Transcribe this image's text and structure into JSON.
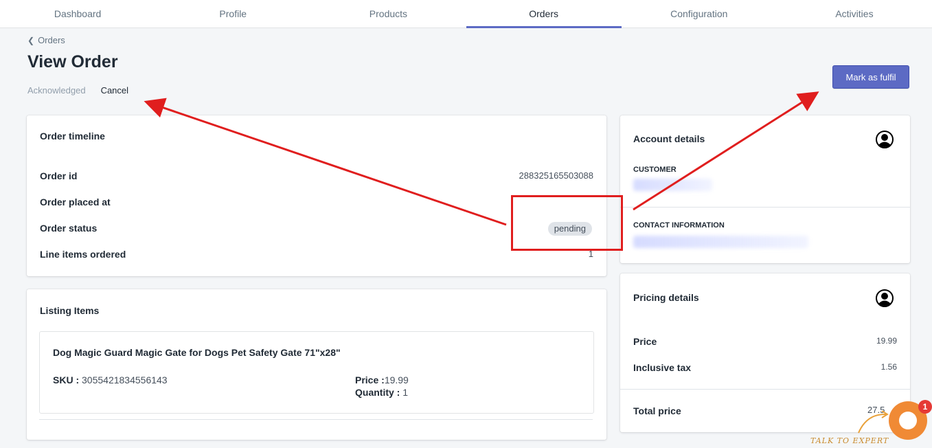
{
  "nav": {
    "tabs": [
      {
        "label": "Dashboard"
      },
      {
        "label": "Profile"
      },
      {
        "label": "Products"
      },
      {
        "label": "Orders"
      },
      {
        "label": "Configuration"
      },
      {
        "label": "Activities"
      }
    ],
    "active": "Orders"
  },
  "breadcrumb": {
    "label": "Orders"
  },
  "page": {
    "title": "View Order",
    "status_acknowledged": "Acknowledged",
    "status_cancel": "Cancel",
    "primary_action": "Mark as fulfil"
  },
  "order_timeline": {
    "title": "Order timeline",
    "rows": [
      {
        "label": "Order id",
        "value": "288325165503088"
      },
      {
        "label": "Order placed at",
        "value": ""
      },
      {
        "label": "Order status",
        "value": "pending"
      },
      {
        "label": "Line items ordered",
        "value": "1"
      }
    ]
  },
  "listing_items": {
    "title": "Listing Items",
    "items": [
      {
        "name": "Dog Magic Guard Magic Gate for Dogs Pet Safety Gate 71\"x28\"",
        "sku_label": "SKU :",
        "sku_value": "3055421834556143",
        "price_label": "Price :",
        "price_value": "19.99",
        "quantity_label": "Quantity :",
        "quantity_value": "1"
      }
    ]
  },
  "account_details": {
    "title": "Account details",
    "customer_label": "CUSTOMER",
    "contact_label": "CONTACT INFORMATION"
  },
  "pricing_details": {
    "title": "Pricing details",
    "rows": [
      {
        "label": "Price",
        "value": "19.99"
      },
      {
        "label": "Inclusive tax",
        "value": "1.56"
      }
    ],
    "total_label": "Total price",
    "total_value": "27.5"
  },
  "chat": {
    "count": "1",
    "label": "TALK TO EXPERT"
  },
  "colors": {
    "accent": "#5c6ac4",
    "annotation": "#e01e1e",
    "chat": "#f08a35"
  }
}
